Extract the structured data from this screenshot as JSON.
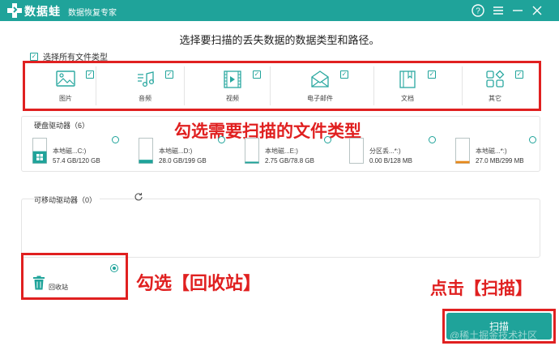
{
  "app": {
    "name": "数据蛙",
    "subtitle": "数据恢复专家"
  },
  "titlebar": {
    "help_glyph": "?",
    "menu_glyph": "≡",
    "minimize_glyph": "—",
    "close_glyph": "✕"
  },
  "heading": "选择要扫描的丢失数据的数据类型和路径。",
  "select_all": {
    "label": "选择所有文件类型",
    "checked": true
  },
  "file_types": [
    {
      "label": "图片",
      "icon": "image-icon",
      "checked": true
    },
    {
      "label": "音频",
      "icon": "audio-icon",
      "checked": true
    },
    {
      "label": "视频",
      "icon": "video-icon",
      "checked": true
    },
    {
      "label": "电子邮件",
      "icon": "email-icon",
      "checked": true
    },
    {
      "label": "文档",
      "icon": "document-icon",
      "checked": true
    },
    {
      "label": "其它",
      "icon": "other-icon",
      "checked": true
    }
  ],
  "hard_drives": {
    "title": "硬盘驱动器（6）",
    "drives": [
      {
        "name": "本地磁...C:)",
        "size": "57.4 GB/120 GB",
        "fill": 0.48,
        "color": "#1fa39a",
        "windows": true
      },
      {
        "name": "本地磁...D:)",
        "size": "28.0 GB/199 GB",
        "fill": 0.14,
        "color": "#1fa39a",
        "windows": false
      },
      {
        "name": "本地磁...E:)",
        "size": "2.75 GB/78.8 GB",
        "fill": 0.03,
        "color": "#1fa39a",
        "windows": false
      },
      {
        "name": "分区丢...*:)",
        "size": "0.00  B/128 MB",
        "fill": 0.0,
        "color": "#e8b040",
        "windows": false
      },
      {
        "name": "本地磁...*:)",
        "size": "27.0 MB/299 MB",
        "fill": 0.09,
        "color": "#e8891a",
        "windows": false
      }
    ]
  },
  "removable": {
    "title": "可移动驱动器（0）"
  },
  "recycle_bin": {
    "label": "回收站",
    "selected": true
  },
  "scan_button": {
    "label": "扫描"
  },
  "annotations": {
    "select_types": "勾选需要扫描的文件类型",
    "select_recycle": "勾选【回收站】",
    "click_scan": "点击【扫描】"
  },
  "watermark": "@稀土掘金技术社区"
}
